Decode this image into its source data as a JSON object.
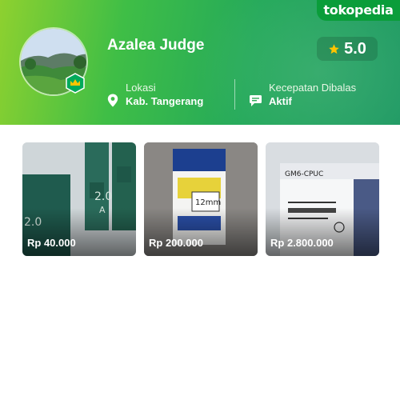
{
  "brand": {
    "logo_text": "tokopedia"
  },
  "shop": {
    "name": "Azalea Judge",
    "rating": "5.0",
    "location_label": "Lokasi",
    "location_value": "Kab. Tangerang",
    "response_label": "Kecepatan Dibalas",
    "response_value": "Aktif"
  },
  "products": [
    {
      "price": "Rp 40.000"
    },
    {
      "price": "Rp 200.000"
    },
    {
      "price": "Rp 2.800.000"
    }
  ],
  "colors": {
    "logo_badge": "#0a9d3a",
    "banner_start": "#8ed12f",
    "banner_end": "#1f9a63",
    "star": "#ffc400",
    "official_badge": "#00aa5b"
  },
  "icons": [
    "star-icon",
    "location-pin-icon",
    "chat-bubble-icon",
    "crown-icon"
  ]
}
